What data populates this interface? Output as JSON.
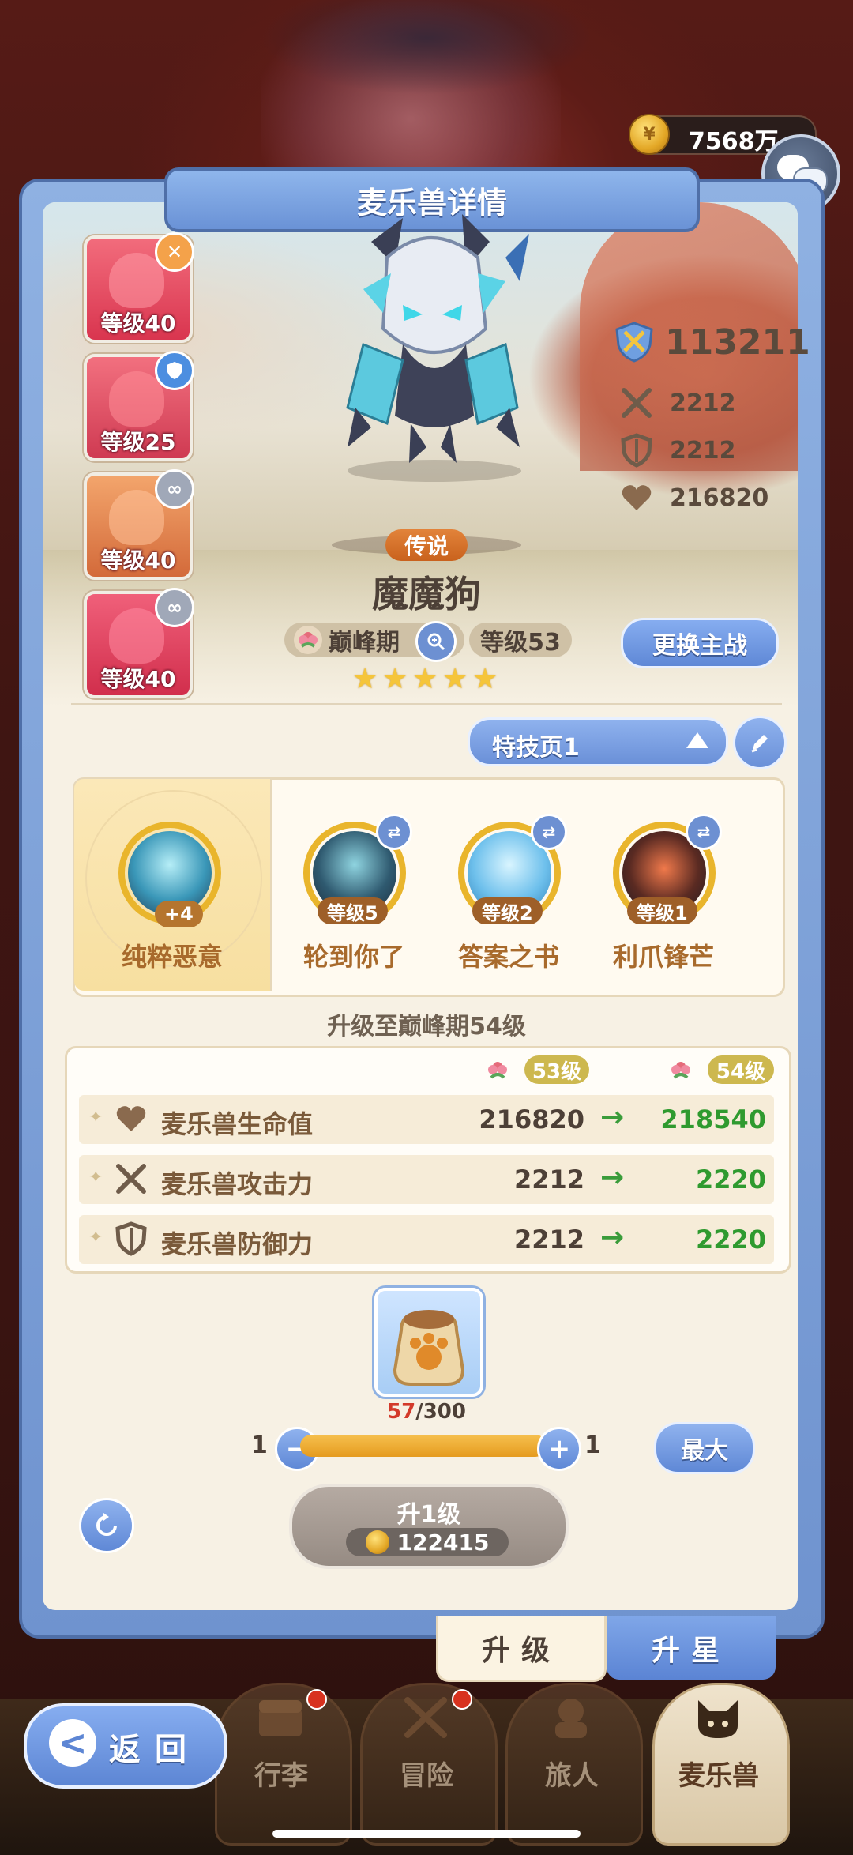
{
  "currency": {
    "amount": "7568万",
    "icon": "gold-coin-icon"
  },
  "chat": {
    "icon": "chat-bubbles-icon"
  },
  "panel_title": "麦乐兽详情",
  "team": [
    {
      "level": "等级40",
      "badge_icon": "close-icon",
      "badge_color": "#f4a24a"
    },
    {
      "level": "等级25",
      "badge_icon": "shield-icon",
      "badge_color": "#4c8ee0"
    },
    {
      "level": "等级40",
      "badge_icon": "link-icon",
      "badge_color": "#a0a8b8"
    },
    {
      "level": "等级40",
      "badge_icon": "link-icon",
      "badge_color": "#a0a8b8"
    }
  ],
  "pet": {
    "power": "113211",
    "attack": "2212",
    "defense": "2212",
    "hp": "216820",
    "rarity": "传说",
    "name": "魔魔狗",
    "stage": "巅峰期",
    "level": "等级53",
    "stars": 5
  },
  "swap_main_label": "更换主战",
  "skill_page": {
    "selected": "特技页1"
  },
  "skills": {
    "main": {
      "name": "纯粹恶意",
      "bonus": "+4"
    },
    "list": [
      {
        "name": "轮到你了",
        "level": "等级5"
      },
      {
        "name": "答案之书",
        "level": "等级2"
      },
      {
        "name": "利爪锋芒",
        "level": "等级1"
      }
    ]
  },
  "upgrade": {
    "title": "升级至巅峰期54级",
    "from_level": "53级",
    "to_level": "54级",
    "rows": [
      {
        "label": "麦乐兽生命值",
        "icon": "heart-icon",
        "current": "216820",
        "next": "218540"
      },
      {
        "label": "麦乐兽攻击力",
        "icon": "crossed-swords-icon",
        "current": "2212",
        "next": "2220"
      },
      {
        "label": "麦乐兽防御力",
        "icon": "shield-icon",
        "current": "2212",
        "next": "2220"
      }
    ],
    "arrow": "→"
  },
  "food": {
    "icon": "paw-food-bag-icon",
    "have": "57",
    "need": "/300",
    "fraction": 0.19
  },
  "quantity": {
    "min": "1",
    "max": "1",
    "minus": "−",
    "plus": "+",
    "max_label": "最大",
    "fill": 1.0
  },
  "levelup": {
    "label": "升1级",
    "cost": "122415"
  },
  "tabs": {
    "upgrade": "升级",
    "star": "升星"
  },
  "back": {
    "label": "返回",
    "chev": "<"
  },
  "nav": [
    {
      "label": "行李",
      "icon": "chest-icon"
    },
    {
      "label": "冒险",
      "icon": "crossed-swords-icon"
    },
    {
      "label": "旅人",
      "icon": "traveler-icon"
    },
    {
      "label": "麦乐兽",
      "icon": "cat-face-icon"
    }
  ]
}
